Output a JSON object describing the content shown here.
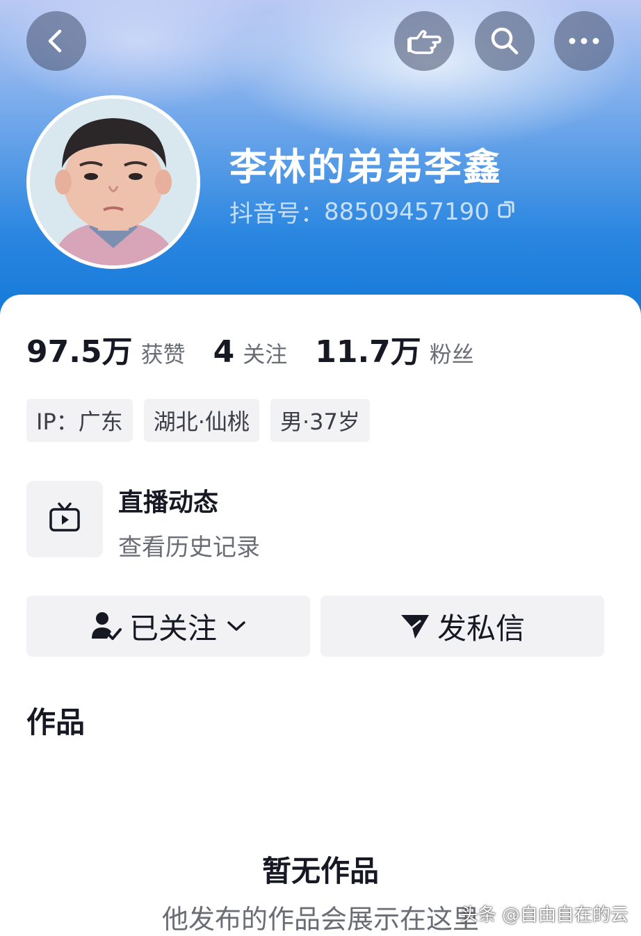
{
  "header": {
    "name": "李林的弟弟李鑫",
    "uid_label": "抖音号：",
    "uid_value": "88509457190",
    "buttons": {
      "back": "back-icon",
      "poke": "pointing-hand-icon",
      "search": "search-icon",
      "more": "more-icon"
    }
  },
  "stats": [
    {
      "value": "97.5万",
      "label": "获赞"
    },
    {
      "value": "4",
      "label": "关注"
    },
    {
      "value": "11.7万",
      "label": "粉丝"
    }
  ],
  "tags": [
    "IP：广东",
    "湖北·仙桃",
    "男·37岁"
  ],
  "live": {
    "title": "直播动态",
    "subtitle": "查看历史记录",
    "icon": "tv-icon"
  },
  "actions": {
    "follow_label": "已关注",
    "message_label": "发私信"
  },
  "works": {
    "title": "作品",
    "empty_title": "暂无作品",
    "empty_subtitle": "他发布的作品会展示在这里"
  },
  "watermark": "头条 @自由自在的云",
  "colors": {
    "header_top": "#b9c9f3",
    "header_bottom": "#1178d8",
    "button_bg": "#f2f2f4",
    "text_primary": "#161823",
    "text_secondary": "#6b6d75"
  }
}
